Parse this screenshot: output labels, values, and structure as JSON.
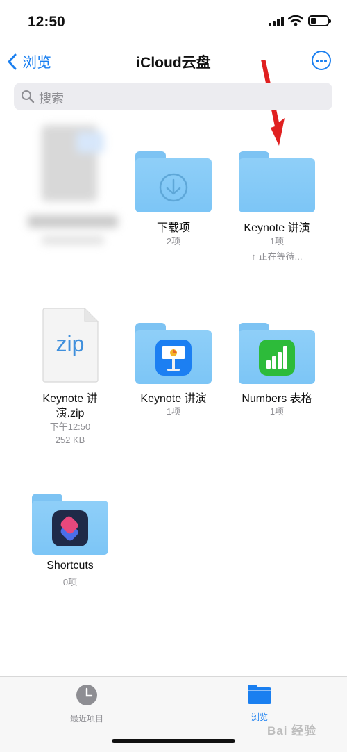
{
  "status_bar": {
    "time": "12:50"
  },
  "nav": {
    "back_label": "浏览",
    "title": "iCloud云盘"
  },
  "search": {
    "placeholder": "搜索"
  },
  "items": [
    {
      "name": "下载项",
      "sub": "2项"
    },
    {
      "name": "Keynote 讲演",
      "sub": "1项",
      "status": "↑ 正在等待..."
    },
    {
      "name_line1": "Keynote 讲",
      "name_line2": "演.zip",
      "time": "下午12:50",
      "size": "252 KB",
      "doc_label": "zip"
    },
    {
      "name": "Keynote 讲演",
      "sub": "1项"
    },
    {
      "name": "Numbers 表格",
      "sub": "1项"
    },
    {
      "name": "Shortcuts",
      "sub": "0项"
    }
  ],
  "tabbar": {
    "recent_label": "最近项目",
    "browse_label": "浏览"
  },
  "watermark": {
    "text": "Bai 经验"
  },
  "colors": {
    "accent": "#1a7ff0",
    "folder": "#86cbf7",
    "arrow": "#e02020"
  }
}
